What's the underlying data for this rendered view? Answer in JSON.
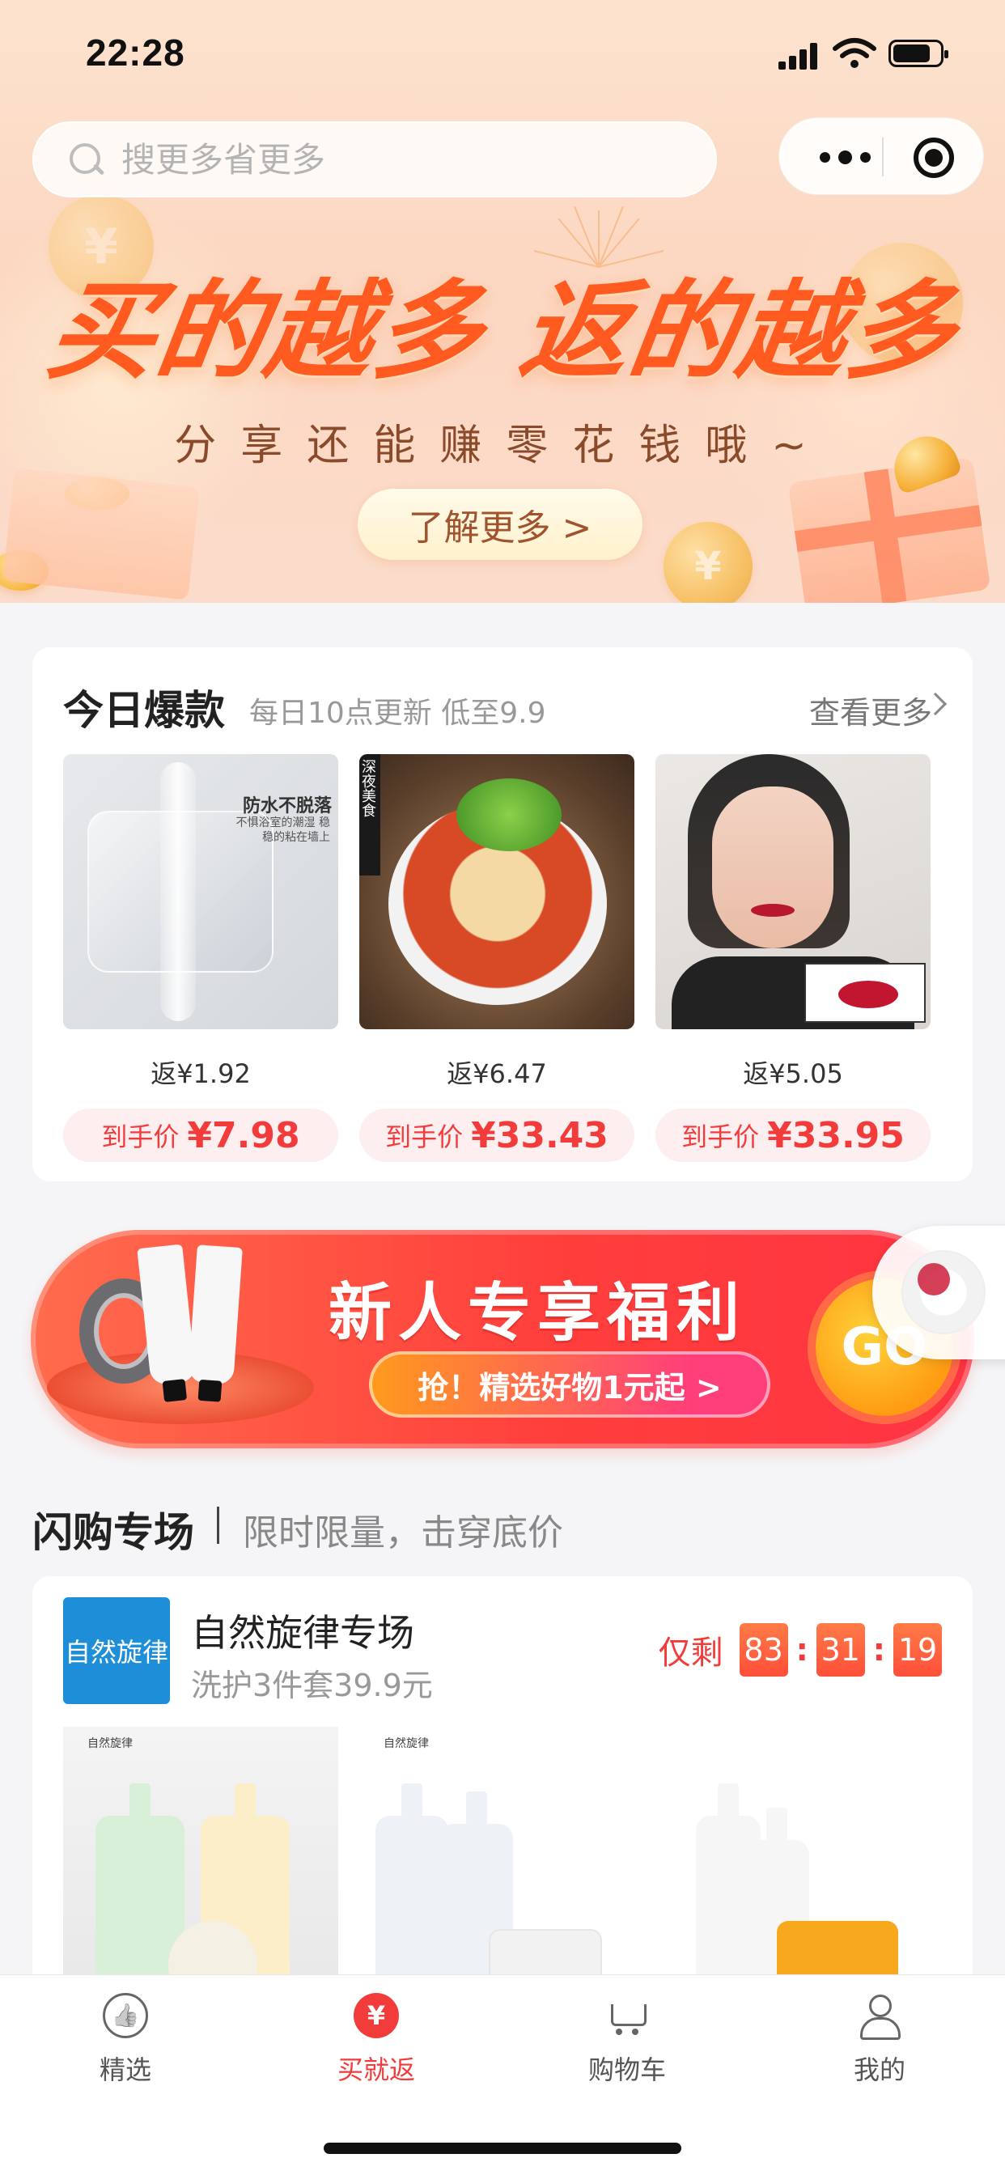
{
  "status_bar": {
    "time": "22:28"
  },
  "search": {
    "placeholder": "搜更多省更多"
  },
  "hero": {
    "title": "买的越多 返的越多",
    "subtitle": "分享还能赚零花钱哦~",
    "button_label": "了解更多 >"
  },
  "hot_picks": {
    "title": "今日爆款",
    "subtitle": "每日10点更新 低至9.9",
    "more_label": "查看更多",
    "price_label": "到手价",
    "items": [
      {
        "rebate": "返¥1.92",
        "price": "¥7.98",
        "img_text_1": "防水不脱落",
        "img_text_2": "不惧浴室的潮湿 稳稳的粘在墙上"
      },
      {
        "rebate": "返¥6.47",
        "price": "¥33.43",
        "img_text_1": "深夜美食"
      },
      {
        "rebate": "返¥5.05",
        "price": "¥33.95"
      }
    ]
  },
  "promo_banner": {
    "title": "新人专享福利",
    "button_label": "抢！精选好物1元起 >",
    "go_label": "GO"
  },
  "flash_sale": {
    "title": "闪购专场",
    "subtitle": "限时限量，击穿底价",
    "brand_logo_text": "自然旋律",
    "brand_name": "自然旋律专场",
    "brand_desc": "洗护3件套39.9元",
    "countdown_label": "仅剩",
    "countdown": [
      "83",
      "31",
      "19"
    ],
    "img_caption_1": "自然旋律",
    "img_caption_2": "自然旋律"
  },
  "tab_bar": {
    "items": [
      {
        "label": "精选",
        "icon": "thumbs-up-icon"
      },
      {
        "label": "买就返",
        "icon": "yen-icon"
      },
      {
        "label": "购物车",
        "icon": "cart-icon"
      },
      {
        "label": "我的",
        "icon": "user-icon"
      }
    ],
    "active_index": 1
  },
  "colors": {
    "accent": "#f23c3c",
    "brand_blue": "#1f8ed8",
    "hero_title": "#ff5a1f"
  }
}
